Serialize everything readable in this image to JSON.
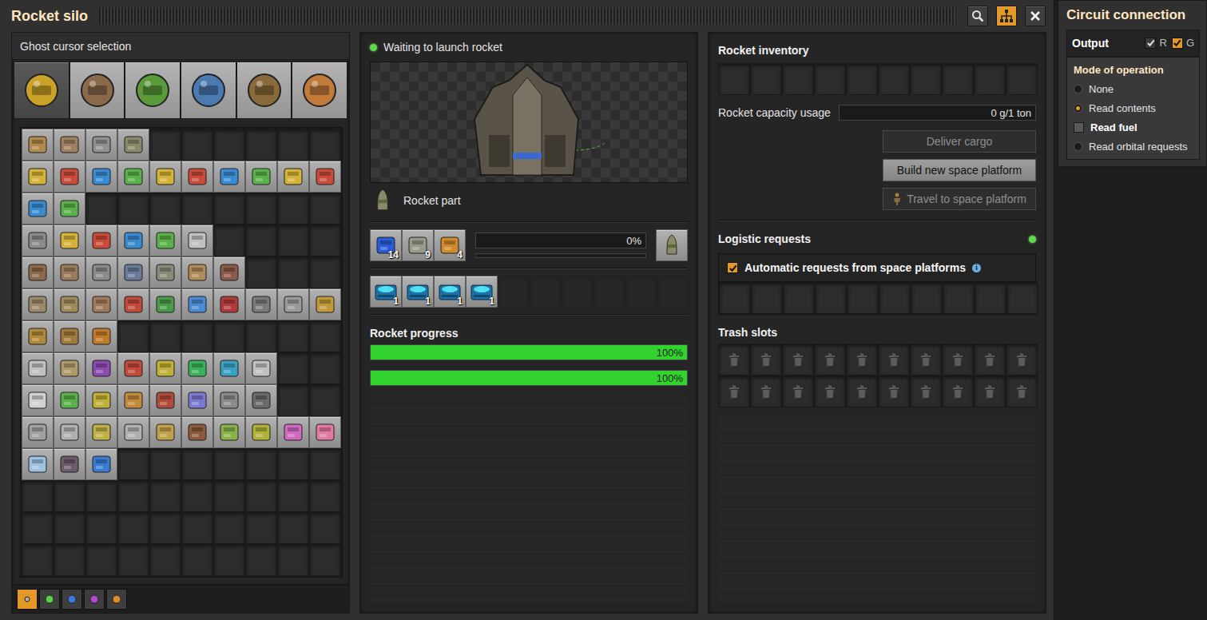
{
  "window": {
    "title": "Rocket silo",
    "header_buttons": [
      {
        "kind": "search",
        "selected": false
      },
      {
        "kind": "circuit",
        "selected": true
      },
      {
        "kind": "close",
        "selected": false
      }
    ]
  },
  "ghost_selection": {
    "title": "Ghost cursor selection",
    "tabs": [
      {
        "selected": true,
        "color": "#c9a227"
      },
      {
        "selected": false,
        "color": "#8a6a4a"
      },
      {
        "selected": false,
        "color": "#5a9a3a"
      },
      {
        "selected": false,
        "color": "#4a7ab0"
      },
      {
        "selected": false,
        "color": "#8a6a3a"
      },
      {
        "selected": false,
        "color": "#c07a3a"
      }
    ],
    "grid_rows": [
      [
        "#b08a4a",
        "#a08060",
        "#909090",
        "#8a8a6a"
      ],
      [
        "#d4b23a",
        "#c84a3a",
        "#3a8ad0",
        "#5ab04a",
        "#d4b23a",
        "#c84a3a",
        "#3a8ad0",
        "#5ab04a",
        "#d4b23a",
        "#c84a3a"
      ],
      [
        "#3a8ad0",
        "#5ab04a"
      ],
      [
        "#8a8a8a",
        "#d4b23a",
        "#c84a3a",
        "#3a8ad0",
        "#5ab04a",
        "#c0c0c0"
      ],
      [
        "#8a6a4a",
        "#9a7a5a",
        "#8a8a8a",
        "#6a7a9a",
        "#8a8a7a",
        "#b08a5a",
        "#8a5a4a"
      ],
      [
        "#9a8a6a",
        "#a08a5a",
        "#a07a5a",
        "#c04a3a",
        "#4a9a4a",
        "#4a8ad0",
        "#b03a3a",
        "#7a7a7a",
        "#9a9a9a",
        "#c09a3a"
      ],
      [
        "#b08a3a",
        "#a07a3a",
        "#c07a2a"
      ],
      [
        "#c0c0c0",
        "#b09a6a",
        "#8a4ab0",
        "#c04a3a",
        "#c0b03a",
        "#3ab05a",
        "#3aa0c0",
        "#c0c0c0"
      ],
      [
        "#d0d0d0",
        "#5ab04a",
        "#c0b03a",
        "#c08a3a",
        "#b04a3a",
        "#7a7ad0",
        "#8a8a8a",
        "#6a6a6a"
      ],
      [
        "#a0a0a0",
        "#b0b0b0",
        "#c0b04a",
        "#b0b0b0",
        "#c0a04a",
        "#8a5a3a",
        "#8ab04a",
        "#b0b03a",
        "#d06ac0",
        "#e07aa0"
      ],
      [
        "#a0c0e0",
        "#6a5a6a",
        "#3a7ad0"
      ],
      [],
      [],
      []
    ],
    "qualities": [
      {
        "selected": true,
        "color": "#b0b0b0"
      },
      {
        "selected": false,
        "color": "#5ad04a"
      },
      {
        "selected": false,
        "color": "#3a7ae0"
      },
      {
        "selected": false,
        "color": "#b04ad0"
      },
      {
        "selected": false,
        "color": "#e08a2a"
      }
    ]
  },
  "status": {
    "label": "Waiting to launch rocket",
    "color": "#5fd94a"
  },
  "recipe": {
    "name": "Rocket part",
    "ingredients": [
      {
        "count": "14",
        "color": "#2a5bd7"
      },
      {
        "count": "9",
        "color": "#9a9a8a"
      },
      {
        "count": "4",
        "color": "#d08a2a"
      }
    ],
    "level": 0,
    "reading": "0%",
    "sub_level": 0
  },
  "modules": [
    {
      "filled": true,
      "count": "1"
    },
    {
      "filled": true,
      "count": "1"
    },
    {
      "filled": true,
      "count": "1"
    },
    {
      "filled": true,
      "count": "1"
    },
    {
      "filled": false
    },
    {
      "filled": false
    },
    {
      "filled": false
    },
    {
      "filled": false
    },
    {
      "filled": false
    },
    {
      "filled": false
    }
  ],
  "rocket_progress": {
    "title": "Rocket progress",
    "bars": [
      {
        "level": 1,
        "reading": "100%"
      },
      {
        "level": 1,
        "reading": "100%"
      }
    ]
  },
  "rocket_inventory": {
    "title": "Rocket inventory",
    "slots": [
      {
        "filled": false
      },
      {
        "filled": false
      },
      {
        "filled": false
      },
      {
        "filled": false
      },
      {
        "filled": false
      },
      {
        "filled": false
      },
      {
        "filled": false
      },
      {
        "filled": false
      },
      {
        "filled": false
      },
      {
        "filled": false
      }
    ]
  },
  "capacity": {
    "label": "Rocket capacity usage",
    "reading": "0 g/1 ton",
    "level": 0
  },
  "actions": [
    {
      "label": "Deliver cargo",
      "disabled": true,
      "kind": "plain"
    },
    {
      "label": "Build new space platform",
      "disabled": false,
      "kind": "plain"
    },
    {
      "label": "Travel to space platform",
      "disabled": true,
      "kind": "travel"
    }
  ],
  "logistics": {
    "title": "Logistic requests",
    "status_color": "#5fd94a",
    "auto": {
      "label": "Automatic requests from space platforms",
      "checked": true,
      "info": "i"
    },
    "slots": [
      {
        "filled": false
      },
      {
        "filled": false
      },
      {
        "filled": false
      },
      {
        "filled": false
      },
      {
        "filled": false
      },
      {
        "filled": false
      },
      {
        "filled": false
      },
      {
        "filled": false
      },
      {
        "filled": false
      },
      {
        "filled": false
      }
    ]
  },
  "trash": {
    "title": "Trash slots",
    "rows": [
      10,
      10
    ]
  },
  "circuit": {
    "title": "Circuit connection",
    "output": {
      "label": "Output",
      "wires": [
        {
          "label": "R",
          "checked": true,
          "color": "#3a393a"
        },
        {
          "label": "G",
          "checked": true,
          "color": "#e39827"
        }
      ]
    },
    "mode": {
      "title": "Mode of operation",
      "options": [
        {
          "label": "None",
          "kind": "radio",
          "selected": false,
          "emphasized": false
        },
        {
          "label": "Read contents",
          "kind": "radio",
          "selected": true,
          "emphasized": false
        },
        {
          "label": "Read fuel",
          "kind": "checkbox",
          "checked": false,
          "emphasized": true
        },
        {
          "label": "Read orbital requests",
          "kind": "radio",
          "selected": false,
          "emphasized": false
        }
      ]
    }
  }
}
